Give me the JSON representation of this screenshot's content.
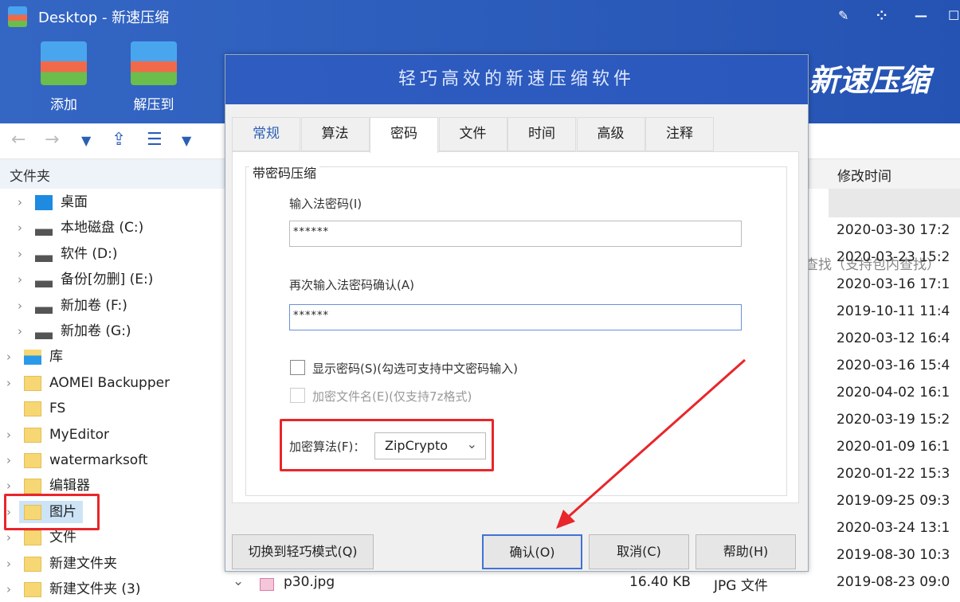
{
  "window": {
    "title": "Desktop - 新速压缩",
    "controls": [
      "edit",
      "apps",
      "minimize",
      "maximize"
    ]
  },
  "ribbon": {
    "add": "添加",
    "extract": "解压到",
    "brand": "新速压缩"
  },
  "search": {
    "placeholder": "查找（支持包内查找）"
  },
  "sidebar": {
    "header": "文件夹",
    "items": [
      {
        "label": "桌面",
        "icon": "desktop-icon"
      },
      {
        "label": "本地磁盘 (C:)",
        "icon": "drive-icon"
      },
      {
        "label": "软件 (D:)",
        "icon": "drive-icon"
      },
      {
        "label": "备份[勿删] (E:)",
        "icon": "drive-icon"
      },
      {
        "label": "新加卷 (F:)",
        "icon": "drive-icon"
      },
      {
        "label": "新加卷 (G:)",
        "icon": "drive-icon"
      },
      {
        "label": "库",
        "icon": "library-icon"
      },
      {
        "label": "AOMEI Backupper",
        "icon": "folder-icon"
      },
      {
        "label": "FS",
        "icon": "folder-icon"
      },
      {
        "label": "MyEditor",
        "icon": "folder-icon"
      },
      {
        "label": "watermarksoft",
        "icon": "folder-icon"
      },
      {
        "label": "编辑器",
        "icon": "folder-icon"
      },
      {
        "label": "图片",
        "icon": "folder-icon",
        "selected": true
      },
      {
        "label": "文件",
        "icon": "folder-icon"
      },
      {
        "label": "新建文件夹",
        "icon": "folder-icon"
      },
      {
        "label": "新建文件夹 (3)",
        "icon": "folder-icon"
      }
    ]
  },
  "filelist": {
    "modified_header": "修改时间",
    "dates": [
      "2020-03-30 17:2",
      "2020-03-23 15:2",
      "2020-03-16 17:1",
      "2019-10-11 11:4",
      "2020-03-12 16:4",
      "2020-03-16 15:4",
      "2020-04-02 16:1",
      "2020-03-19 15:2",
      "2020-01-09 16:1",
      "2020-01-22 15:3",
      "2019-09-25 09:3",
      "2020-03-24 13:1",
      "2019-08-30 10:3"
    ],
    "last_row": {
      "name": "p30.jpg",
      "size": "16.40 KB",
      "type": "JPG 文件",
      "date": "2019-08-23 09:0"
    }
  },
  "dialog": {
    "title": "轻巧高效的新速压缩软件",
    "tabs": [
      "常规",
      "算法",
      "密码",
      "文件",
      "时间",
      "高级",
      "注释"
    ],
    "active_tab": 2,
    "group_label": "带密码压缩",
    "password_label": "输入法密码(I)",
    "password_value": "******",
    "confirm_label": "再次输入法密码确认(A)",
    "confirm_value": "******",
    "show_password": "显示密码(S)(勾选可支持中文密码输入)",
    "encrypt_names": "加密文件名(E)(仅支持7z格式)",
    "algorithm_label": "加密算法(F)：",
    "algorithm_value": "ZipCrypto",
    "buttons": {
      "switch": "切换到轻巧模式(Q)",
      "ok": "确认(O)",
      "cancel": "取消(C)",
      "help": "帮助(H)"
    }
  },
  "colors": {
    "accent": "#2f5fbf",
    "highlight": "#e8262b"
  }
}
